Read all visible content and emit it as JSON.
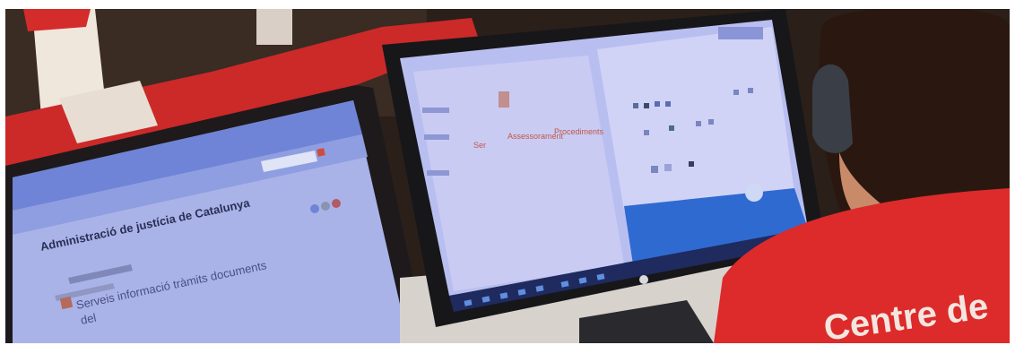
{
  "scene": {
    "laptop_screen": {
      "title": "Administració de justícia de Catalunya",
      "link_text": "Serveis  informació  tràmits  documents",
      "link_text2": "del"
    },
    "monitor_screen": {
      "text_1": "Ser",
      "text_2": "Assessorament",
      "text_3": "Procediments"
    },
    "shirt_text": "Centre de"
  }
}
